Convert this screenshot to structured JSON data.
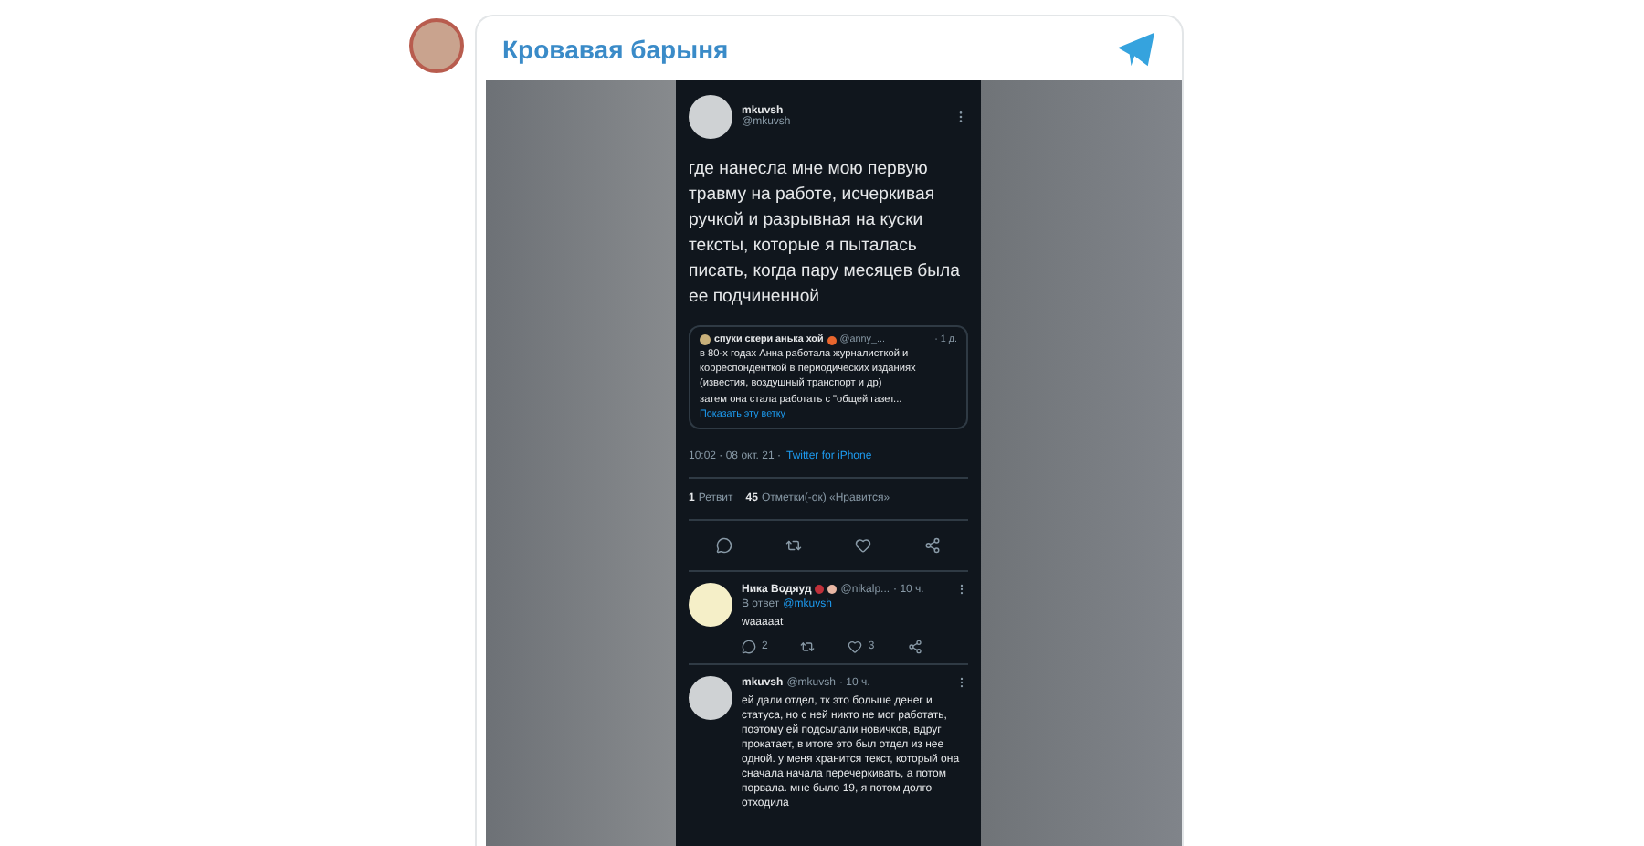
{
  "channel": {
    "name": "Кровавая барыня"
  },
  "tweet": {
    "author": "mkuvsh",
    "handle": "@mkuvsh",
    "text": "где нанесла мне мою первую травму на работе, исчеркивая ручкой и разрывная на куски тексты, которые я пыталась писать, когда пару месяцев была ее подчиненной",
    "quote": {
      "author": "спуки скери анька хой",
      "handle": "@anny_...",
      "time": "· 1 д.",
      "text": "в 80-х годах Анна работала журналисткой и корреспонденткой в периодических изданиях (известия, воздушный транспорт и др)",
      "text2": "затем она стала работать с \"общей газет...",
      "link": "Показать эту ветку"
    },
    "timestamp": "10:02 · 08 окт. 21 ·",
    "source": "Twitter for iPhone",
    "stats": [
      {
        "count": "1",
        "label": "Ретвит"
      },
      {
        "count": "45",
        "label": "Отметки(-ок) «Нравится»"
      }
    ]
  },
  "replies": [
    {
      "author": "Ника Водяуд",
      "handle": "@nikalp...",
      "time": "· 10 ч.",
      "reply_to_label": "В ответ",
      "reply_to": "@mkuvsh",
      "text": "waaaaat",
      "replies": "2",
      "likes": "3"
    },
    {
      "author": "mkuvsh",
      "handle": "@mkuvsh",
      "time": "· 10 ч.",
      "text": "ей дали отдел, тк это больше денег и статуса, но с ней никто не мог работать, поэтому ей подсылали новичков, вдруг прокатает, в итоге это был отдел из нее одной. у меня хранится текст, который она сначала начала перечеркивать, а потом порвала. мне было 19, я потом долго отходила"
    }
  ]
}
